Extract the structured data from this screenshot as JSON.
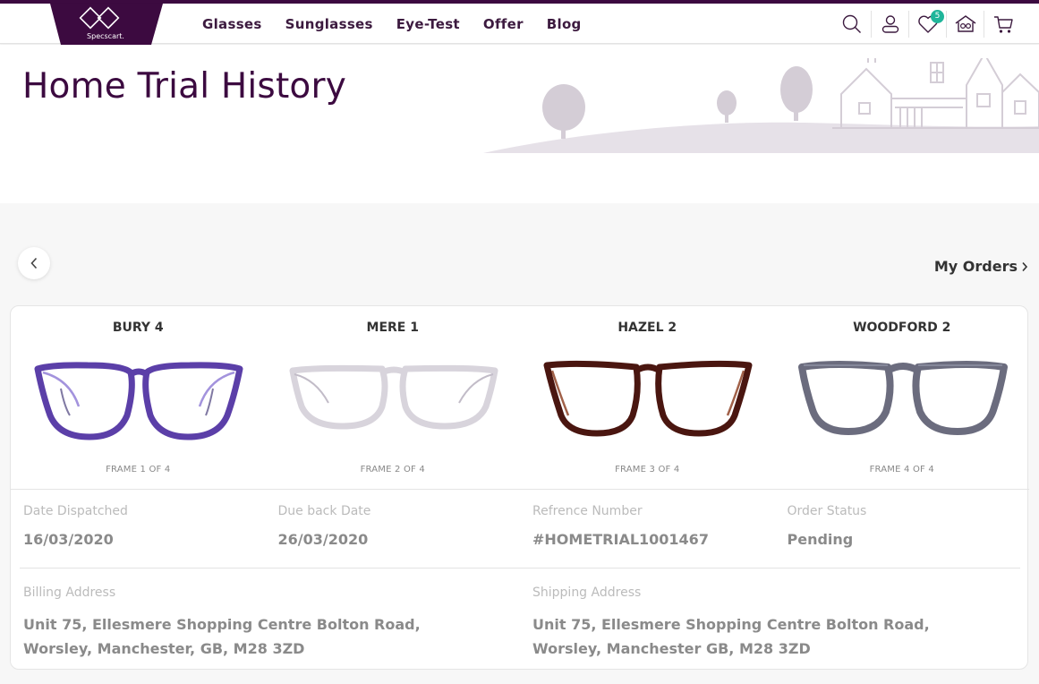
{
  "header": {
    "brand": "Specscart.",
    "nav": [
      "Glasses",
      "Sunglasses",
      "Eye-Test",
      "Offer",
      "Blog"
    ],
    "wishlist_count": "5",
    "icons": [
      "search-icon",
      "user-icon",
      "heart-icon",
      "home-trial-icon",
      "cart-icon"
    ]
  },
  "banner": {
    "title": "Home Trial History"
  },
  "toolbar": {
    "my_orders": "My Orders"
  },
  "frames": [
    {
      "name": "BURY 4",
      "count": "FRAME 1 OF 4"
    },
    {
      "name": "MERE 1",
      "count": "FRAME 2 OF 4"
    },
    {
      "name": "HAZEL 2",
      "count": "FRAME 3 OF 4"
    },
    {
      "name": "WOODFORD 2",
      "count": "FRAME 4 OF 4"
    }
  ],
  "details": [
    {
      "label": "Date Dispatched",
      "value": "16/03/2020"
    },
    {
      "label": "Due back Date",
      "value": "26/03/2020"
    },
    {
      "label": "Refrence Number",
      "value": "#HOMETRIAL1001467"
    },
    {
      "label": "Order Status",
      "value": "Pending"
    }
  ],
  "addresses": [
    {
      "label": "Billing Address",
      "value": "Unit 75, Ellesmere Shopping Centre Bolton Road, Worsley, Manchester, GB, M28 3ZD"
    },
    {
      "label": "Shipping Address",
      "value": "Unit 75, Ellesmere Shopping Centre Bolton Road, Worsley, Manchester GB, M28 3ZD"
    }
  ],
  "colors": {
    "brand": "#3c0a40",
    "badge": "#1fb59a"
  }
}
